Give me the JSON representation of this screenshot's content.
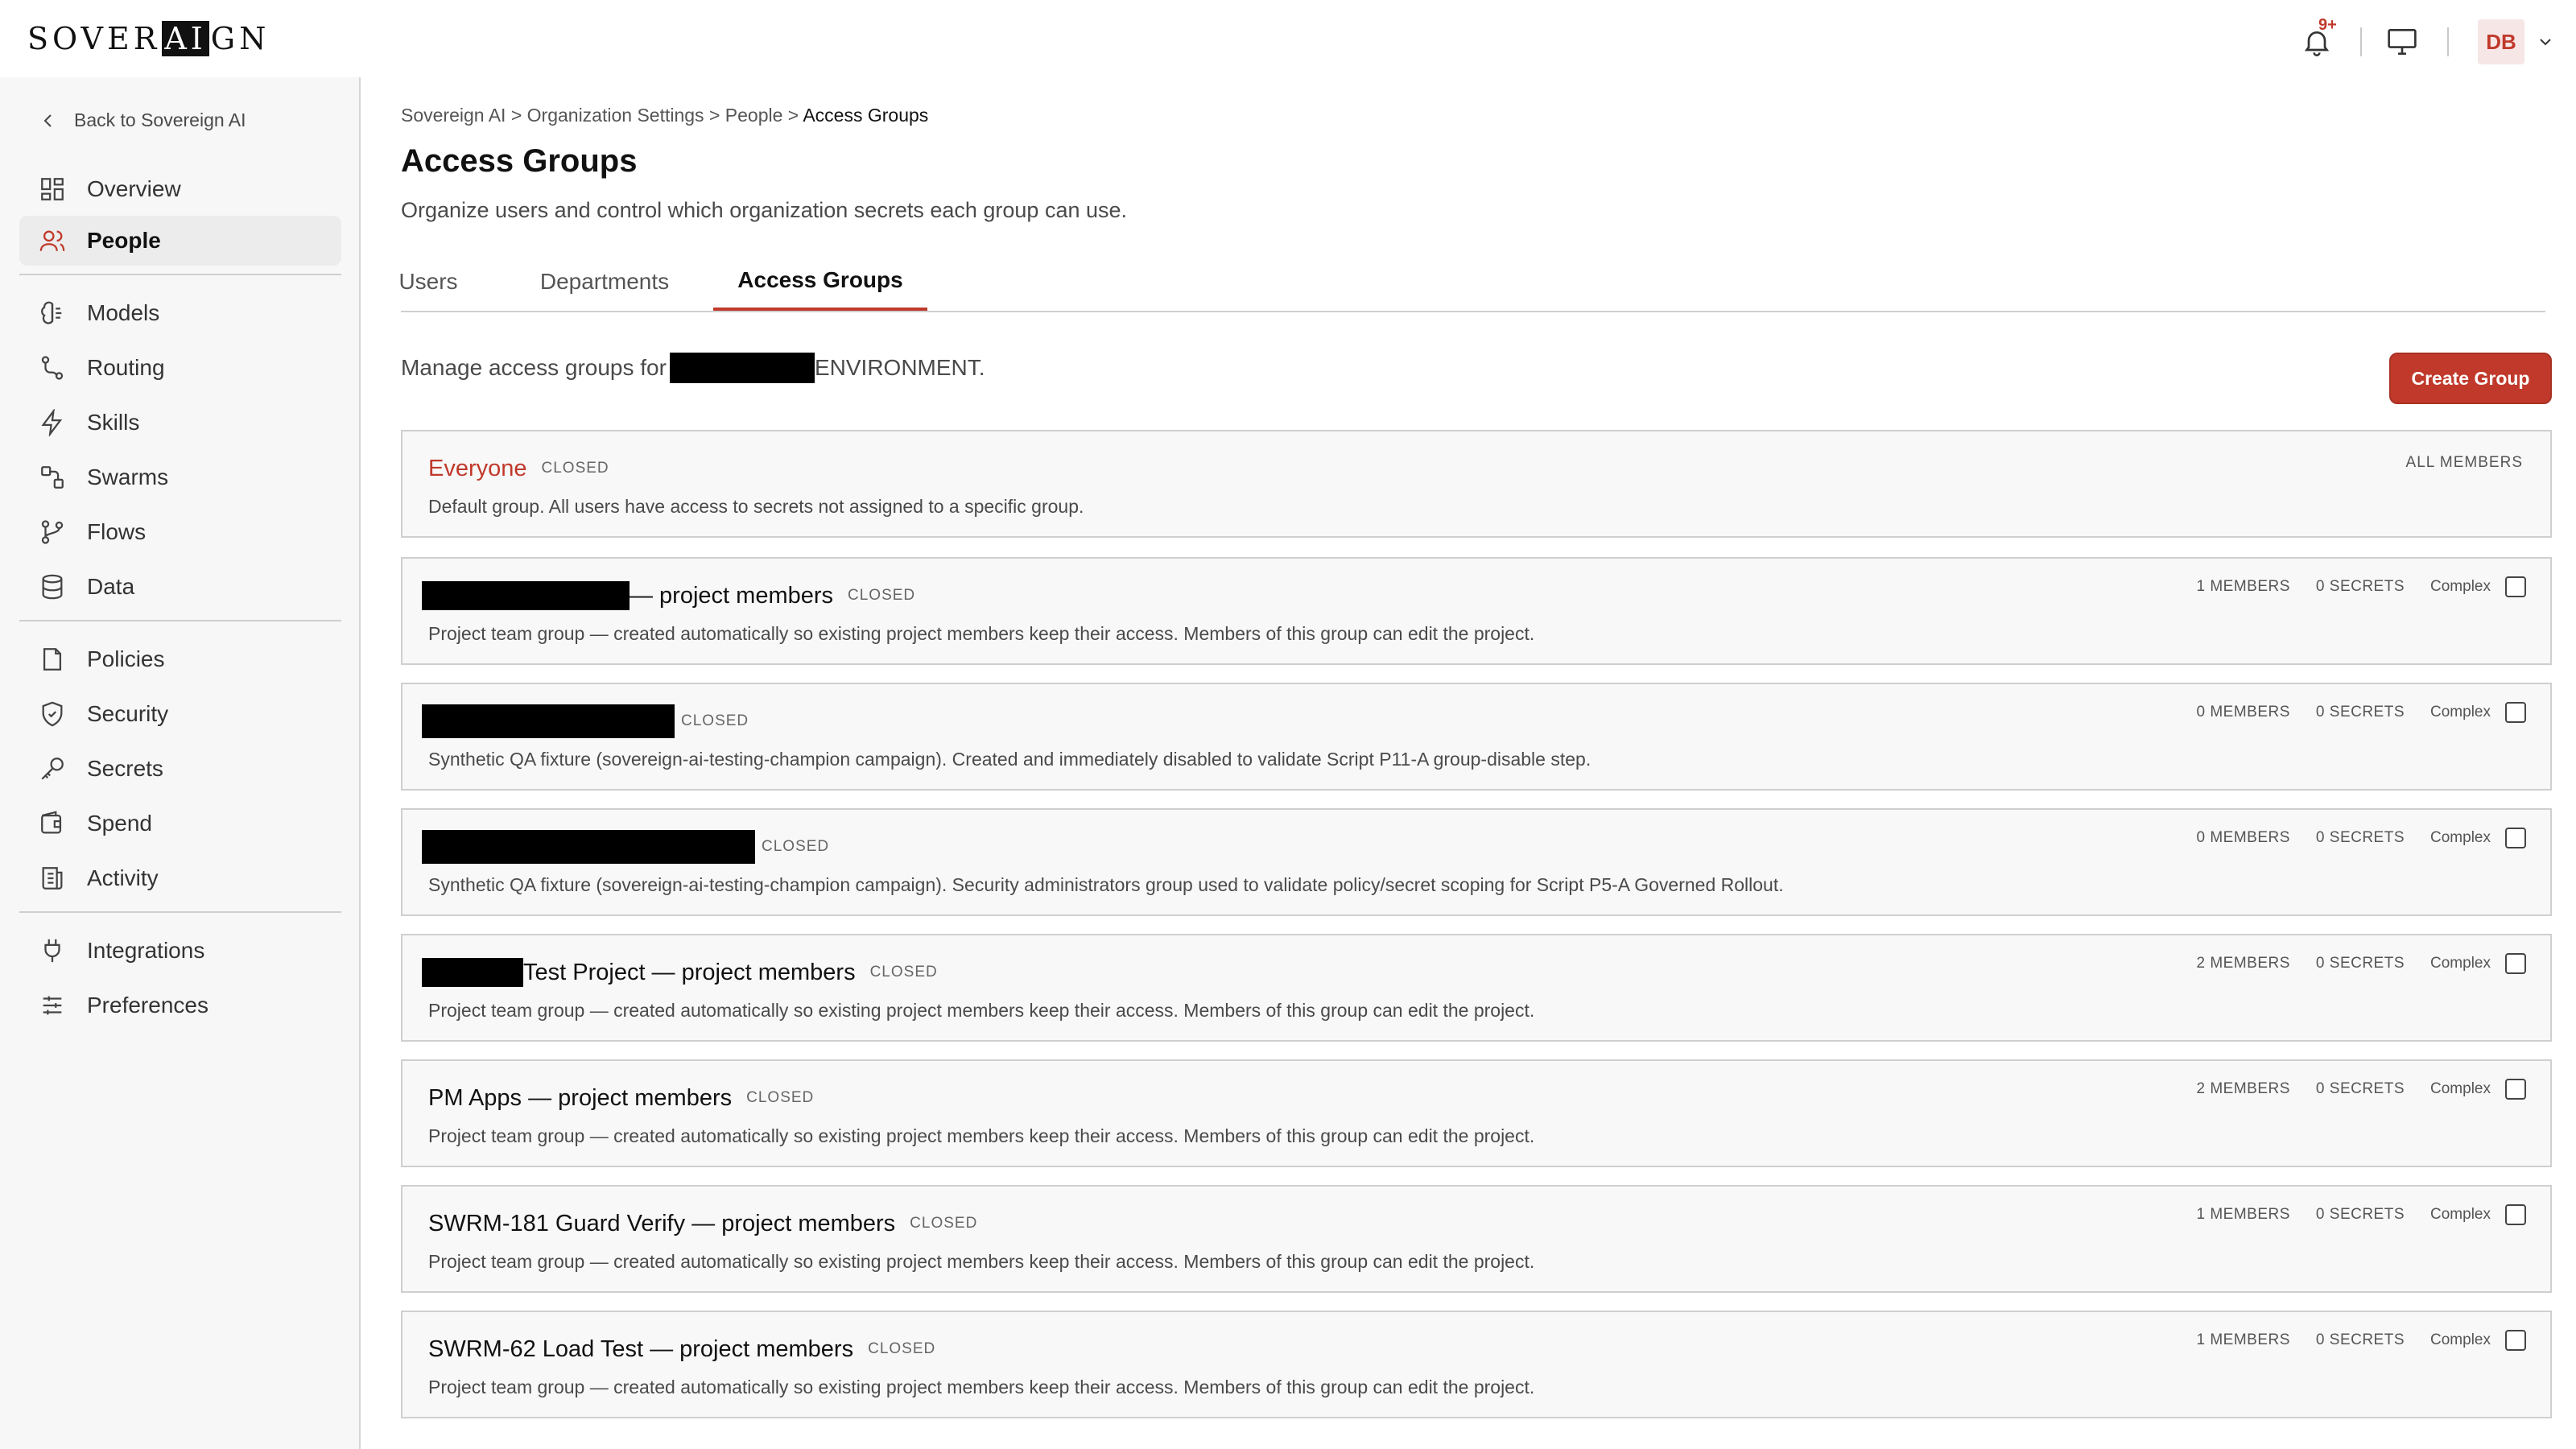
{
  "app": {
    "logo_text_pre": "SOVER",
    "logo_text_highlight": "AI",
    "logo_text_post": "GN",
    "notification_badge": "9+",
    "user_initials": "DB",
    "accent": "#c0392b"
  },
  "sidebar": {
    "back_label": "Back to Sovereign AI",
    "items": [
      {
        "label": "Overview",
        "icon": "grid-icon"
      },
      {
        "label": "People",
        "icon": "users-icon"
      },
      {
        "label": "Models",
        "icon": "brain-icon"
      },
      {
        "label": "Routing",
        "icon": "route-icon"
      },
      {
        "label": "Skills",
        "icon": "lightning-icon"
      },
      {
        "label": "Swarms",
        "icon": "swarm-icon"
      },
      {
        "label": "Flows",
        "icon": "branch-icon"
      },
      {
        "label": "Data",
        "icon": "database-icon"
      },
      {
        "label": "Policies",
        "icon": "document-icon"
      },
      {
        "label": "Security",
        "icon": "shield-icon"
      },
      {
        "label": "Secrets",
        "icon": "key-icon"
      },
      {
        "label": "Spend",
        "icon": "wallet-icon"
      },
      {
        "label": "Activity",
        "icon": "activity-icon"
      },
      {
        "label": "Integrations",
        "icon": "plug-icon"
      },
      {
        "label": "Preferences",
        "icon": "sliders-icon"
      }
    ]
  },
  "breadcrumb": {
    "items": [
      "Sovereign AI",
      "Organization Settings",
      "People"
    ],
    "separator": ">",
    "current": "Access Groups"
  },
  "page": {
    "title": "Access Groups",
    "description": "Organize users and control which organization secrets each group can use.",
    "manage_prefix": "Manage access groups for",
    "manage_suffix": "ENVIRONMENT.",
    "create_button": "Create Group"
  },
  "tabs": [
    {
      "label": "Users",
      "active": false
    },
    {
      "label": "Departments",
      "active": false
    },
    {
      "label": "Access Groups",
      "active": true
    }
  ],
  "groups": {
    "everyone": {
      "name": "Everyone",
      "status": "CLOSED",
      "description": "Default group. All users have access to secrets not assigned to a specific group.",
      "members_label": "ALL MEMBERS"
    },
    "complex_label": "Complex",
    "list": [
      {
        "name": "— project members",
        "status": "CLOSED",
        "description": "Project team group — created automatically so existing project members keep their access. Members of this group can edit the project.",
        "members": "1 MEMBERS",
        "secrets": "0 SECRETS"
      },
      {
        "name": "",
        "status": "CLOSED",
        "description": "Synthetic QA fixture (sovereign-ai-testing-champion campaign). Created and immediately disabled to validate Script P11-A group-disable step.",
        "members": "0 MEMBERS",
        "secrets": "0 SECRETS"
      },
      {
        "name": "",
        "status": "CLOSED",
        "description": "Synthetic QA fixture (sovereign-ai-testing-champion campaign). Security administrators group used to validate policy/secret scoping for Script P5-A Governed Rollout.",
        "members": "0 MEMBERS",
        "secrets": "0 SECRETS"
      },
      {
        "name": "Test Project — project members",
        "status": "CLOSED",
        "description": "Project team group — created automatically so existing project members keep their access. Members of this group can edit the project.",
        "members": "2 MEMBERS",
        "secrets": "0 SECRETS"
      },
      {
        "name": "PM Apps — project members",
        "status": "CLOSED",
        "description": "Project team group — created automatically so existing project members keep their access. Members of this group can edit the project.",
        "members": "2 MEMBERS",
        "secrets": "0 SECRETS"
      },
      {
        "name": "SWRM-181 Guard Verify — project members",
        "status": "CLOSED",
        "description": "Project team group — created automatically so existing project members keep their access. Members of this group can edit the project.",
        "members": "1 MEMBERS",
        "secrets": "0 SECRETS"
      },
      {
        "name": "SWRM-62 Load Test — project members",
        "status": "CLOSED",
        "description": "Project team group — created automatically so existing project members keep their access. Members of this group can edit the project.",
        "members": "1 MEMBERS",
        "secrets": "0 SECRETS"
      }
    ]
  }
}
